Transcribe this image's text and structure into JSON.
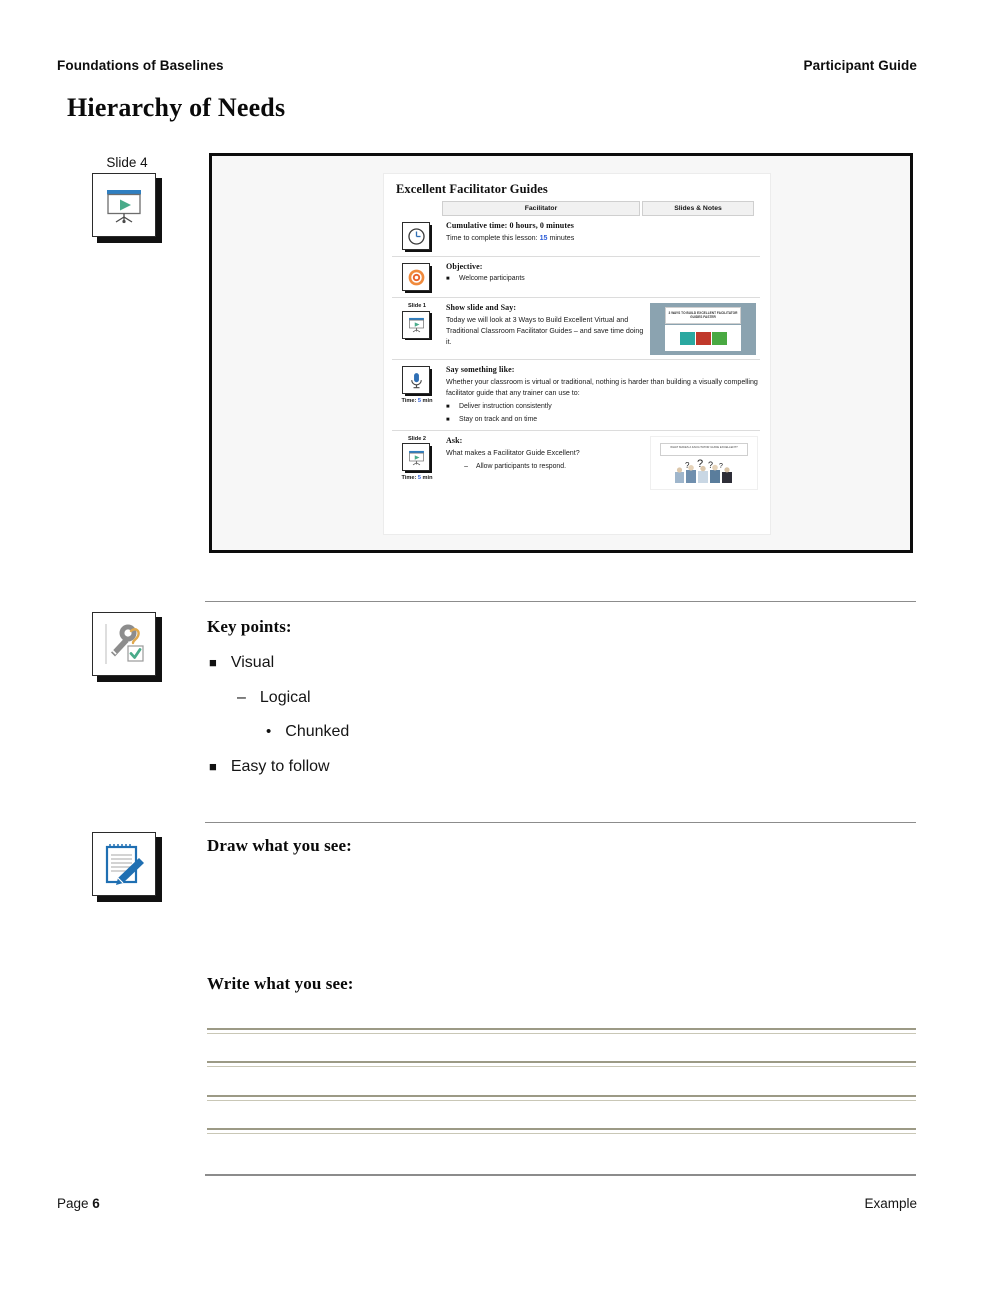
{
  "header": {
    "left": "Foundations of Baselines",
    "right": "Participant Guide"
  },
  "title": "Hierarchy of Needs",
  "slide_ref": {
    "caption": "Slide 4",
    "icon": "projector-screen-icon"
  },
  "facilitator_guide": {
    "title": "Excellent Facilitator Guides",
    "columns": [
      "Facilitator",
      "Slides & Notes"
    ],
    "rows": [
      {
        "icon": "clock-icon",
        "heading": "Cumulative time: 0 hours, 0 minutes",
        "body_prefix": "Time to complete this lesson: ",
        "body_accent": "15",
        "body_suffix": " minutes"
      },
      {
        "icon": "target-icon",
        "heading": "Objective:",
        "bullets": [
          "Welcome participants"
        ]
      },
      {
        "icon": "projector-screen-icon",
        "icon_caption": "Slide 1",
        "heading": "Show slide and Say:",
        "paragraph": "Today we will look at 3 Ways to Build Excellent Virtual and Traditional Classroom Facilitator Guides – and save time doing it.",
        "thumbnail": {
          "name": "slide-thumbnail-3-ways",
          "title": "3 WAYS TO BUILD EXCELLENT FACILITATOR GUIDES FASTER",
          "box_colors": [
            "#2aa8a0",
            "#c0392b",
            "#49a942"
          ]
        }
      },
      {
        "icon": "microphone-icon",
        "time_prefix": "Time: ",
        "time_value": "5",
        "time_suffix": " min",
        "heading": "Say something like:",
        "paragraph": "Whether your classroom is virtual or traditional, nothing is harder than building a visually compelling facilitator guide that any trainer can use to:",
        "bullets": [
          "Deliver instruction consistently",
          "Stay on track and on time"
        ]
      },
      {
        "icon": "projector-screen-icon",
        "icon_caption": "Slide 2",
        "time_prefix": "Time: ",
        "time_value": "5",
        "time_suffix": " min",
        "heading": "Ask:",
        "paragraph": "What makes a Facilitator Guide Excellent?",
        "dash_bullets": [
          "Allow participants to respond."
        ],
        "thumbnail": {
          "name": "slide-thumbnail-what-makes",
          "title": "WHAT MAKES A FACILITATOR GUIDE EXCELLENT?"
        }
      }
    ]
  },
  "key_points": {
    "icon": "key-check-icon",
    "heading": "Key points:",
    "items": [
      {
        "level": 1,
        "marker": "■",
        "text": "Visual"
      },
      {
        "level": 2,
        "marker": "–",
        "text": "Logical"
      },
      {
        "level": 3,
        "marker": "•",
        "text": "Chunked"
      },
      {
        "level": 1,
        "marker": "■",
        "text": "Easy to follow"
      }
    ]
  },
  "draw_section": {
    "icon": "notepad-pencil-icon",
    "heading": "Draw what you see:"
  },
  "write_section": {
    "heading": "Write what you see:",
    "line_count": 4
  },
  "footer": {
    "page_label": "Page ",
    "page_number": "6",
    "right": "Example"
  },
  "colors": {
    "accent_blue": "#2b5bd7",
    "rule_gray": "#8c8c8c",
    "write_line": "#9c9a86"
  }
}
